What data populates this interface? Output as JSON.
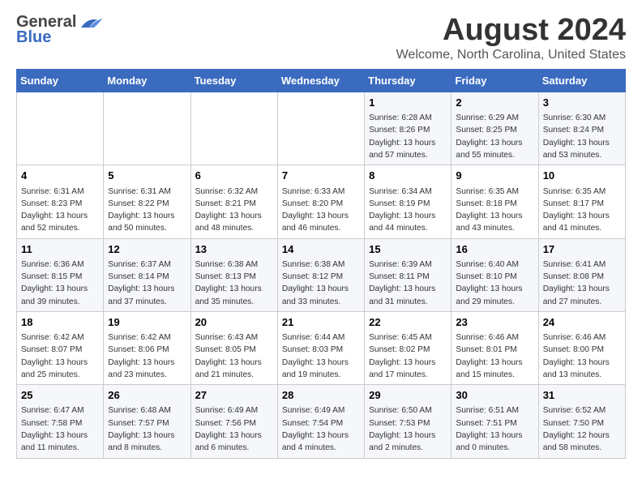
{
  "logo": {
    "general": "General",
    "blue": "Blue"
  },
  "title": "August 2024",
  "location": "Welcome, North Carolina, United States",
  "days_of_week": [
    "Sunday",
    "Monday",
    "Tuesday",
    "Wednesday",
    "Thursday",
    "Friday",
    "Saturday"
  ],
  "weeks": [
    [
      {
        "day": "",
        "info": ""
      },
      {
        "day": "",
        "info": ""
      },
      {
        "day": "",
        "info": ""
      },
      {
        "day": "",
        "info": ""
      },
      {
        "day": "1",
        "info": "Sunrise: 6:28 AM\nSunset: 8:26 PM\nDaylight: 13 hours\nand 57 minutes."
      },
      {
        "day": "2",
        "info": "Sunrise: 6:29 AM\nSunset: 8:25 PM\nDaylight: 13 hours\nand 55 minutes."
      },
      {
        "day": "3",
        "info": "Sunrise: 6:30 AM\nSunset: 8:24 PM\nDaylight: 13 hours\nand 53 minutes."
      }
    ],
    [
      {
        "day": "4",
        "info": "Sunrise: 6:31 AM\nSunset: 8:23 PM\nDaylight: 13 hours\nand 52 minutes."
      },
      {
        "day": "5",
        "info": "Sunrise: 6:31 AM\nSunset: 8:22 PM\nDaylight: 13 hours\nand 50 minutes."
      },
      {
        "day": "6",
        "info": "Sunrise: 6:32 AM\nSunset: 8:21 PM\nDaylight: 13 hours\nand 48 minutes."
      },
      {
        "day": "7",
        "info": "Sunrise: 6:33 AM\nSunset: 8:20 PM\nDaylight: 13 hours\nand 46 minutes."
      },
      {
        "day": "8",
        "info": "Sunrise: 6:34 AM\nSunset: 8:19 PM\nDaylight: 13 hours\nand 44 minutes."
      },
      {
        "day": "9",
        "info": "Sunrise: 6:35 AM\nSunset: 8:18 PM\nDaylight: 13 hours\nand 43 minutes."
      },
      {
        "day": "10",
        "info": "Sunrise: 6:35 AM\nSunset: 8:17 PM\nDaylight: 13 hours\nand 41 minutes."
      }
    ],
    [
      {
        "day": "11",
        "info": "Sunrise: 6:36 AM\nSunset: 8:15 PM\nDaylight: 13 hours\nand 39 minutes."
      },
      {
        "day": "12",
        "info": "Sunrise: 6:37 AM\nSunset: 8:14 PM\nDaylight: 13 hours\nand 37 minutes."
      },
      {
        "day": "13",
        "info": "Sunrise: 6:38 AM\nSunset: 8:13 PM\nDaylight: 13 hours\nand 35 minutes."
      },
      {
        "day": "14",
        "info": "Sunrise: 6:38 AM\nSunset: 8:12 PM\nDaylight: 13 hours\nand 33 minutes."
      },
      {
        "day": "15",
        "info": "Sunrise: 6:39 AM\nSunset: 8:11 PM\nDaylight: 13 hours\nand 31 minutes."
      },
      {
        "day": "16",
        "info": "Sunrise: 6:40 AM\nSunset: 8:10 PM\nDaylight: 13 hours\nand 29 minutes."
      },
      {
        "day": "17",
        "info": "Sunrise: 6:41 AM\nSunset: 8:08 PM\nDaylight: 13 hours\nand 27 minutes."
      }
    ],
    [
      {
        "day": "18",
        "info": "Sunrise: 6:42 AM\nSunset: 8:07 PM\nDaylight: 13 hours\nand 25 minutes."
      },
      {
        "day": "19",
        "info": "Sunrise: 6:42 AM\nSunset: 8:06 PM\nDaylight: 13 hours\nand 23 minutes."
      },
      {
        "day": "20",
        "info": "Sunrise: 6:43 AM\nSunset: 8:05 PM\nDaylight: 13 hours\nand 21 minutes."
      },
      {
        "day": "21",
        "info": "Sunrise: 6:44 AM\nSunset: 8:03 PM\nDaylight: 13 hours\nand 19 minutes."
      },
      {
        "day": "22",
        "info": "Sunrise: 6:45 AM\nSunset: 8:02 PM\nDaylight: 13 hours\nand 17 minutes."
      },
      {
        "day": "23",
        "info": "Sunrise: 6:46 AM\nSunset: 8:01 PM\nDaylight: 13 hours\nand 15 minutes."
      },
      {
        "day": "24",
        "info": "Sunrise: 6:46 AM\nSunset: 8:00 PM\nDaylight: 13 hours\nand 13 minutes."
      }
    ],
    [
      {
        "day": "25",
        "info": "Sunrise: 6:47 AM\nSunset: 7:58 PM\nDaylight: 13 hours\nand 11 minutes."
      },
      {
        "day": "26",
        "info": "Sunrise: 6:48 AM\nSunset: 7:57 PM\nDaylight: 13 hours\nand 8 minutes."
      },
      {
        "day": "27",
        "info": "Sunrise: 6:49 AM\nSunset: 7:56 PM\nDaylight: 13 hours\nand 6 minutes."
      },
      {
        "day": "28",
        "info": "Sunrise: 6:49 AM\nSunset: 7:54 PM\nDaylight: 13 hours\nand 4 minutes."
      },
      {
        "day": "29",
        "info": "Sunrise: 6:50 AM\nSunset: 7:53 PM\nDaylight: 13 hours\nand 2 minutes."
      },
      {
        "day": "30",
        "info": "Sunrise: 6:51 AM\nSunset: 7:51 PM\nDaylight: 13 hours\nand 0 minutes."
      },
      {
        "day": "31",
        "info": "Sunrise: 6:52 AM\nSunset: 7:50 PM\nDaylight: 12 hours\nand 58 minutes."
      }
    ]
  ]
}
